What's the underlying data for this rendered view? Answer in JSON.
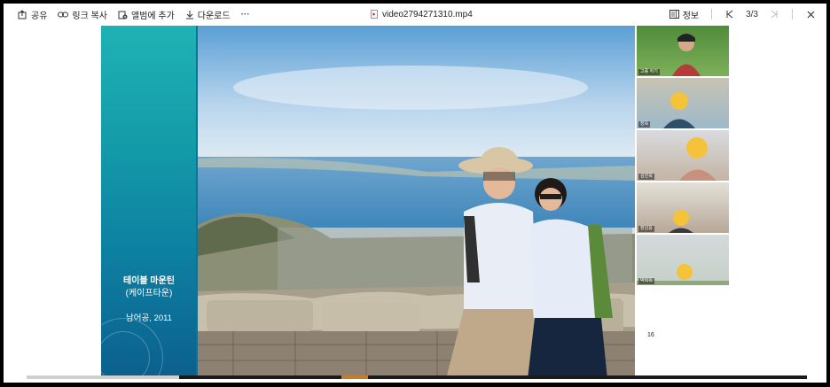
{
  "toolbar": {
    "share_label": "공유",
    "copy_link_label": "링크 복사",
    "add_to_album_label": "앨범에 추가",
    "download_label": "다운로드",
    "more_label": "···",
    "file_name": "video2794271310.mp4",
    "info_label": "정보",
    "page_counter": "3/3"
  },
  "slide": {
    "title_line1": "테이블 마운틴",
    "title_line2": "(케이프타운)",
    "caption": "남어공, 2011",
    "slide_number": "16"
  },
  "participants": [
    {
      "name": "고종 하기"
    },
    {
      "name": "장옥"
    },
    {
      "name": "김진옥"
    },
    {
      "name": "장남웅"
    },
    {
      "name": "박희옥"
    }
  ],
  "colors": {
    "accent_teal": "#139aa8",
    "toolbar_bg": "#ffffff",
    "window_bg": "#000000"
  }
}
